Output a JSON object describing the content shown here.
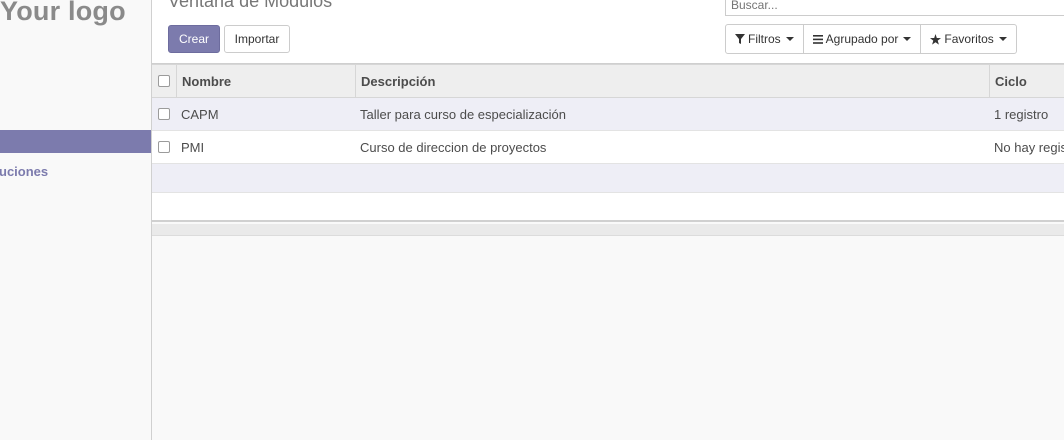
{
  "sidebar": {
    "logo": "Your logo",
    "link_label": "uciones"
  },
  "control_panel": {
    "title": "Ventana de Modulos",
    "create_label": "Crear",
    "import_label": "Importar",
    "search_placeholder": "Buscar...",
    "filters_label": "Filtros",
    "group_by_label": "Agrupado por",
    "favorites_label": "Favoritos"
  },
  "table": {
    "columns": [
      "Nombre",
      "Descripción",
      "Ciclo"
    ],
    "rows": [
      {
        "nombre": "CAPM",
        "descripcion": "Taller para curso de especialización",
        "ciclo": "1 registro"
      },
      {
        "nombre": "PMI",
        "descripcion": "Curso de direccion de proyectos",
        "ciclo": "No hay registros"
      }
    ]
  },
  "colors": {
    "accent": "#7c7bad",
    "row_odd": "#eeeef6",
    "header_bg": "#eeeeee"
  }
}
